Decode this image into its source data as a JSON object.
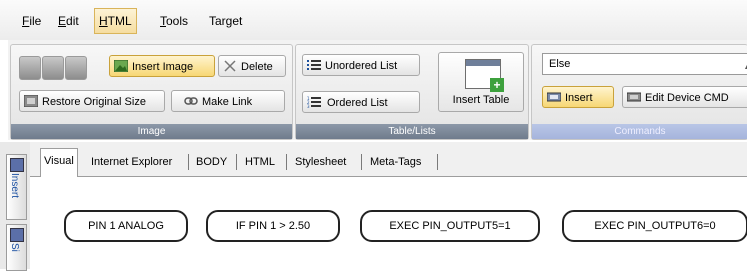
{
  "menu": {
    "file": {
      "first": "F",
      "rest": "ile"
    },
    "edit": {
      "first": "E",
      "rest": "dit"
    },
    "html": {
      "first": "H",
      "rest": "TML"
    },
    "tools": {
      "first": "T",
      "rest": "ools"
    },
    "target": {
      "pre": "Tar",
      "u": "g",
      "post": "et"
    }
  },
  "ribbon": {
    "image_group": {
      "insert_image": "Insert Image",
      "delete": "Delete",
      "restore_original_size": "Restore Original Size",
      "make_link": "Make Link",
      "footer": "Image"
    },
    "table_group": {
      "unordered_list": "Unordered List",
      "ordered_list": "Ordered List",
      "insert_table": "Insert Table",
      "footer": "Table/Lists"
    },
    "commands_group": {
      "combo_value": "Else",
      "insert": "Insert",
      "edit_device_cmd": "Edit Device CMD",
      "footer": "Commands"
    }
  },
  "sidebar": {
    "insert_tab": "Insert",
    "si_tab": "Si"
  },
  "tabs": [
    "Visual",
    "Internet Explorer",
    "BODY",
    "HTML",
    "Stylesheet",
    "Meta-Tags"
  ],
  "nodes": [
    "PIN 1 ANALOG",
    "IF PIN 1 > 2.50",
    "EXEC PIN_OUTPUT5=1",
    "EXEC PIN_OUTPUT6=0"
  ],
  "colors": {
    "active_tab_highlight": "#f7d774",
    "group_footer": "#7b8798",
    "commands_footer": "#aebce0"
  }
}
